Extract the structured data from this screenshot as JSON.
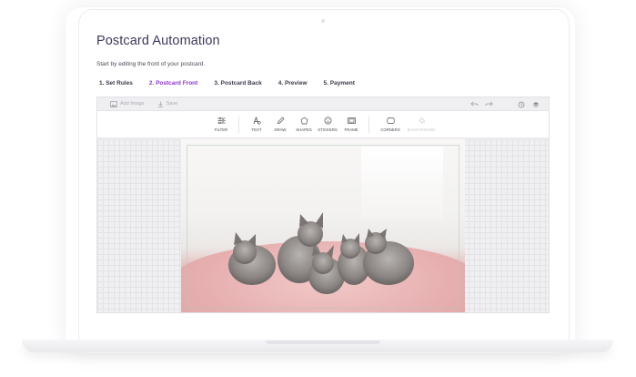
{
  "page": {
    "title": "Postcard Automation",
    "subtitle": "Start by editing the front of your postcard."
  },
  "steps": [
    {
      "label": "1. Set Rules",
      "active": false
    },
    {
      "label": "2. Postcard Front",
      "active": true
    },
    {
      "label": "3. Postcard Back",
      "active": false
    },
    {
      "label": "4. Preview",
      "active": false
    },
    {
      "label": "5. Payment",
      "active": false
    }
  ],
  "editor": {
    "topbar": {
      "add_image": "Add Image",
      "save": "Save"
    },
    "tools": {
      "filter": "FILTER",
      "text": "TEXT",
      "draw": "DRAW",
      "shapes": "SHAPES",
      "stickers": "STICKERS",
      "frame": "FRAME",
      "corners": "CORNERS",
      "background": "BACKGROUND"
    }
  },
  "colors": {
    "accent": "#8a36c8",
    "title": "#3d3a5c"
  }
}
